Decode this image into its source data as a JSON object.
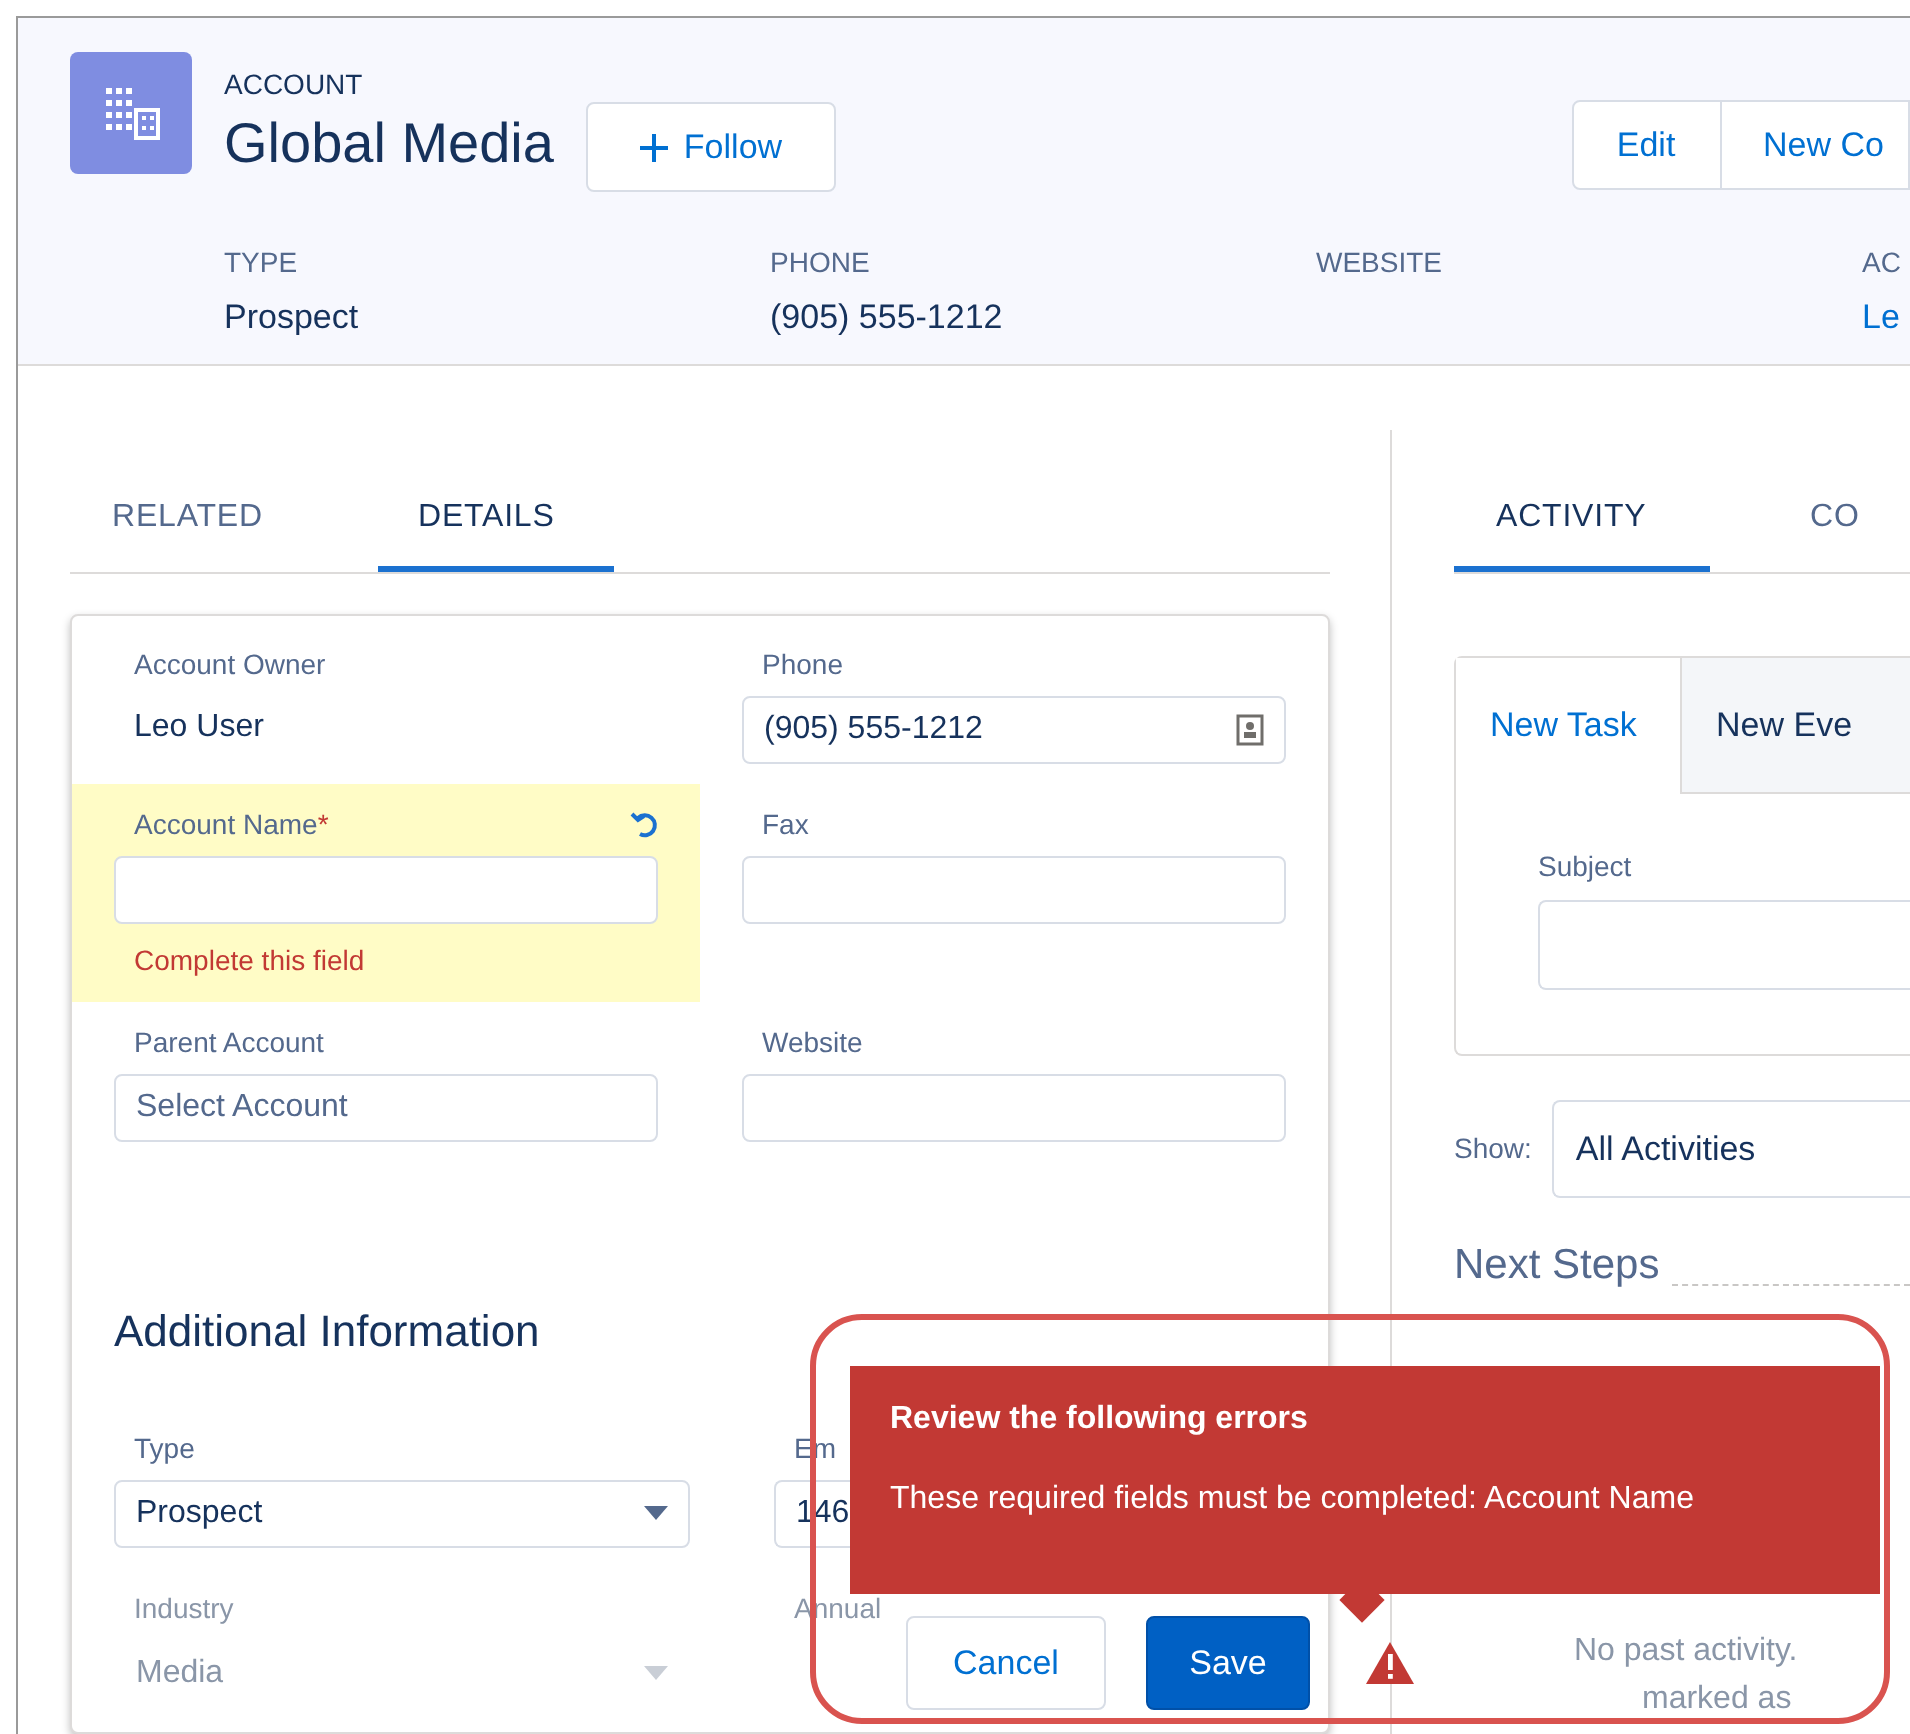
{
  "header": {
    "object_label": "ACCOUNT",
    "title": "Global Media",
    "follow_button": "Follow",
    "actions": [
      "Edit",
      "New Co"
    ],
    "fields": [
      {
        "label": "TYPE",
        "value": "Prospect",
        "kind": "text"
      },
      {
        "label": "PHONE",
        "value": "(905) 555-1212",
        "kind": "text"
      },
      {
        "label": "WEBSITE"
      },
      {
        "label": "AC",
        "value": "Le",
        "kind": "link"
      }
    ]
  },
  "left_tabs": [
    {
      "label": "RELATED",
      "selected": false
    },
    {
      "label": "DETAILS",
      "selected": true
    }
  ],
  "form": {
    "fields": [
      {
        "kind": "readonly",
        "label": "Account Owner",
        "value": "Leo User"
      },
      {
        "kind": "input",
        "label": "Phone",
        "value": "(905) 555-1212",
        "icon": true
      },
      {
        "kind": "input",
        "label": "Account Name",
        "required_mark": "*",
        "error": "Complete this field",
        "undo": true
      },
      {
        "kind": "input",
        "label": "Fax"
      },
      {
        "kind": "input",
        "label": "Parent Account",
        "placeholder": "Select Account"
      },
      {
        "kind": "input",
        "label": "Website"
      }
    ],
    "section_title": "Additional Information",
    "extra_fields": [
      {
        "kind": "select",
        "label": "Type",
        "value": "Prospect",
        "disabled": false
      },
      {
        "kind": "input",
        "label": "Em",
        "value": "146",
        "disabled": false
      },
      {
        "kind": "select",
        "label": "Industry",
        "value": "Media",
        "disabled": true
      },
      {
        "kind": "input",
        "label": "Annual",
        "disabled": true
      }
    ]
  },
  "right_tabs": [
    {
      "label": "ACTIVITY",
      "selected": true
    },
    {
      "label": "CO",
      "selected": false
    }
  ],
  "activity": {
    "composer_tabs": [
      {
        "label": "New Task",
        "selected": true
      },
      {
        "label": "New Eve",
        "selected": false
      }
    ],
    "subject_label": "Subject",
    "show_label": "Show:",
    "show_value": "All Activities",
    "next_steps": "Next Steps",
    "past_lines": [
      "No past activity.",
      "marked as"
    ]
  },
  "error_popover": {
    "title": "Review the following errors",
    "message": "These required fields must be completed: Account Name"
  },
  "footer_buttons": [
    {
      "label": "Cancel",
      "kind": "neutral"
    },
    {
      "label": "Save",
      "kind": "brand"
    }
  ]
}
